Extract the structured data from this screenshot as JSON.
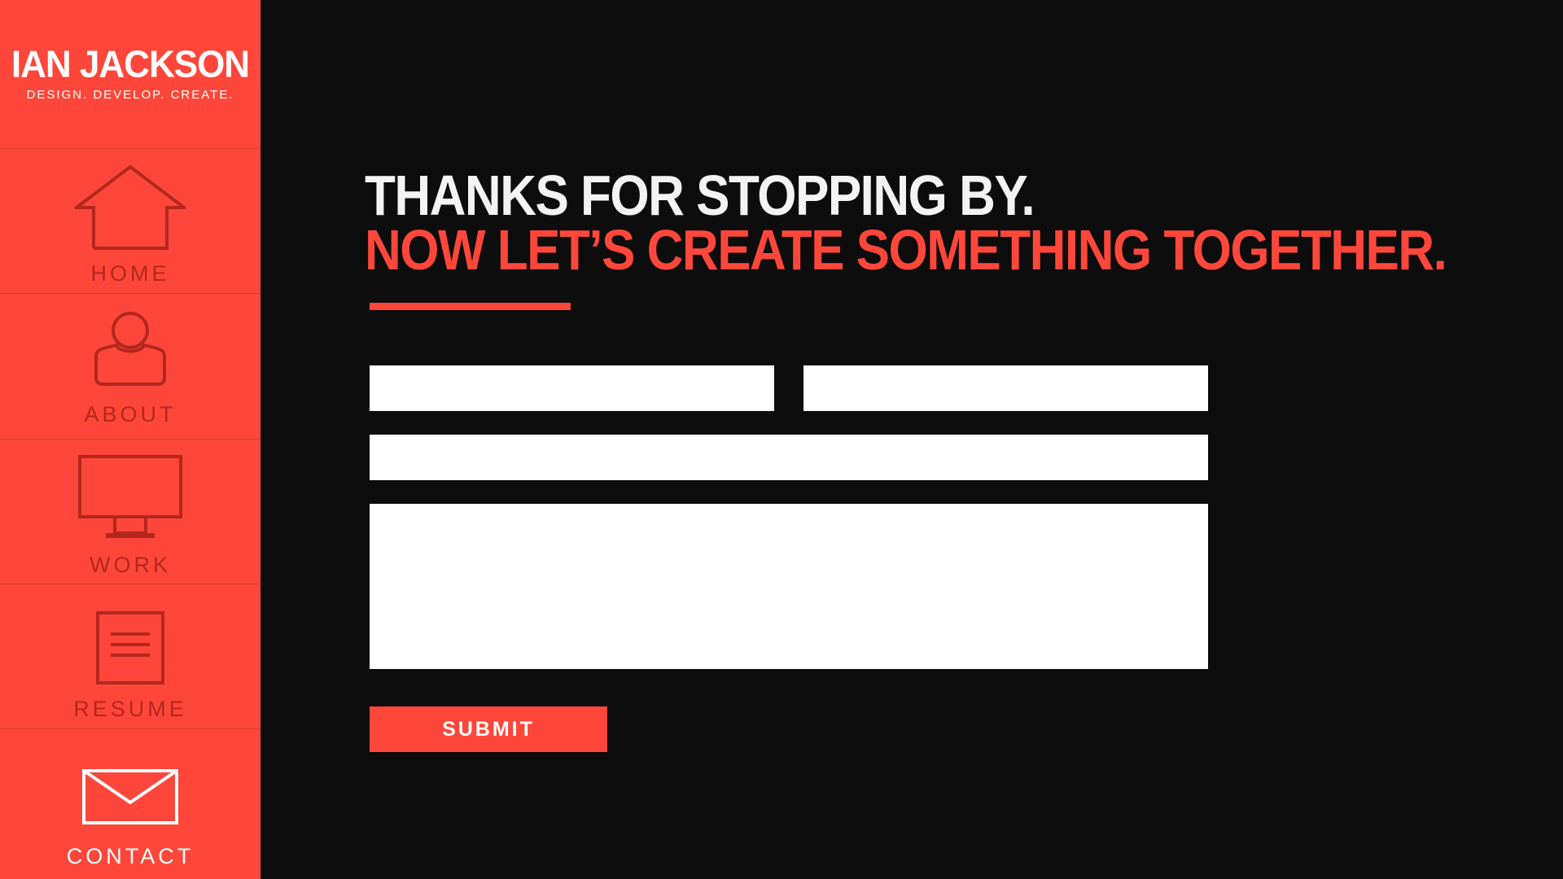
{
  "brand": {
    "name": "IAN JACKSON",
    "tagline": "DESIGN. DEVELOP. CREATE."
  },
  "nav": {
    "items": [
      {
        "label": "HOME",
        "icon": "home-icon"
      },
      {
        "label": "ABOUT",
        "icon": "user-icon"
      },
      {
        "label": "WORK",
        "icon": "monitor-icon"
      },
      {
        "label": "RESUME",
        "icon": "document-icon"
      },
      {
        "label": "CONTACT",
        "icon": "envelope-icon",
        "active": true
      }
    ]
  },
  "contact": {
    "headline_line1": "THANKS FOR STOPPING BY.",
    "headline_line2": "NOW LET’S CREATE SOMETHING TOGETHER.",
    "form": {
      "first_name": {
        "value": "",
        "placeholder": ""
      },
      "last_name": {
        "value": "",
        "placeholder": ""
      },
      "email": {
        "value": "",
        "placeholder": ""
      },
      "message": {
        "value": "",
        "placeholder": ""
      },
      "submit_label": "SUBMIT"
    }
  },
  "colors": {
    "accent": "#fe473a",
    "background": "#0d0d0d",
    "nav_label": "#b3271e",
    "nav_label_active": "#ffffff",
    "field": "#ffffff"
  }
}
